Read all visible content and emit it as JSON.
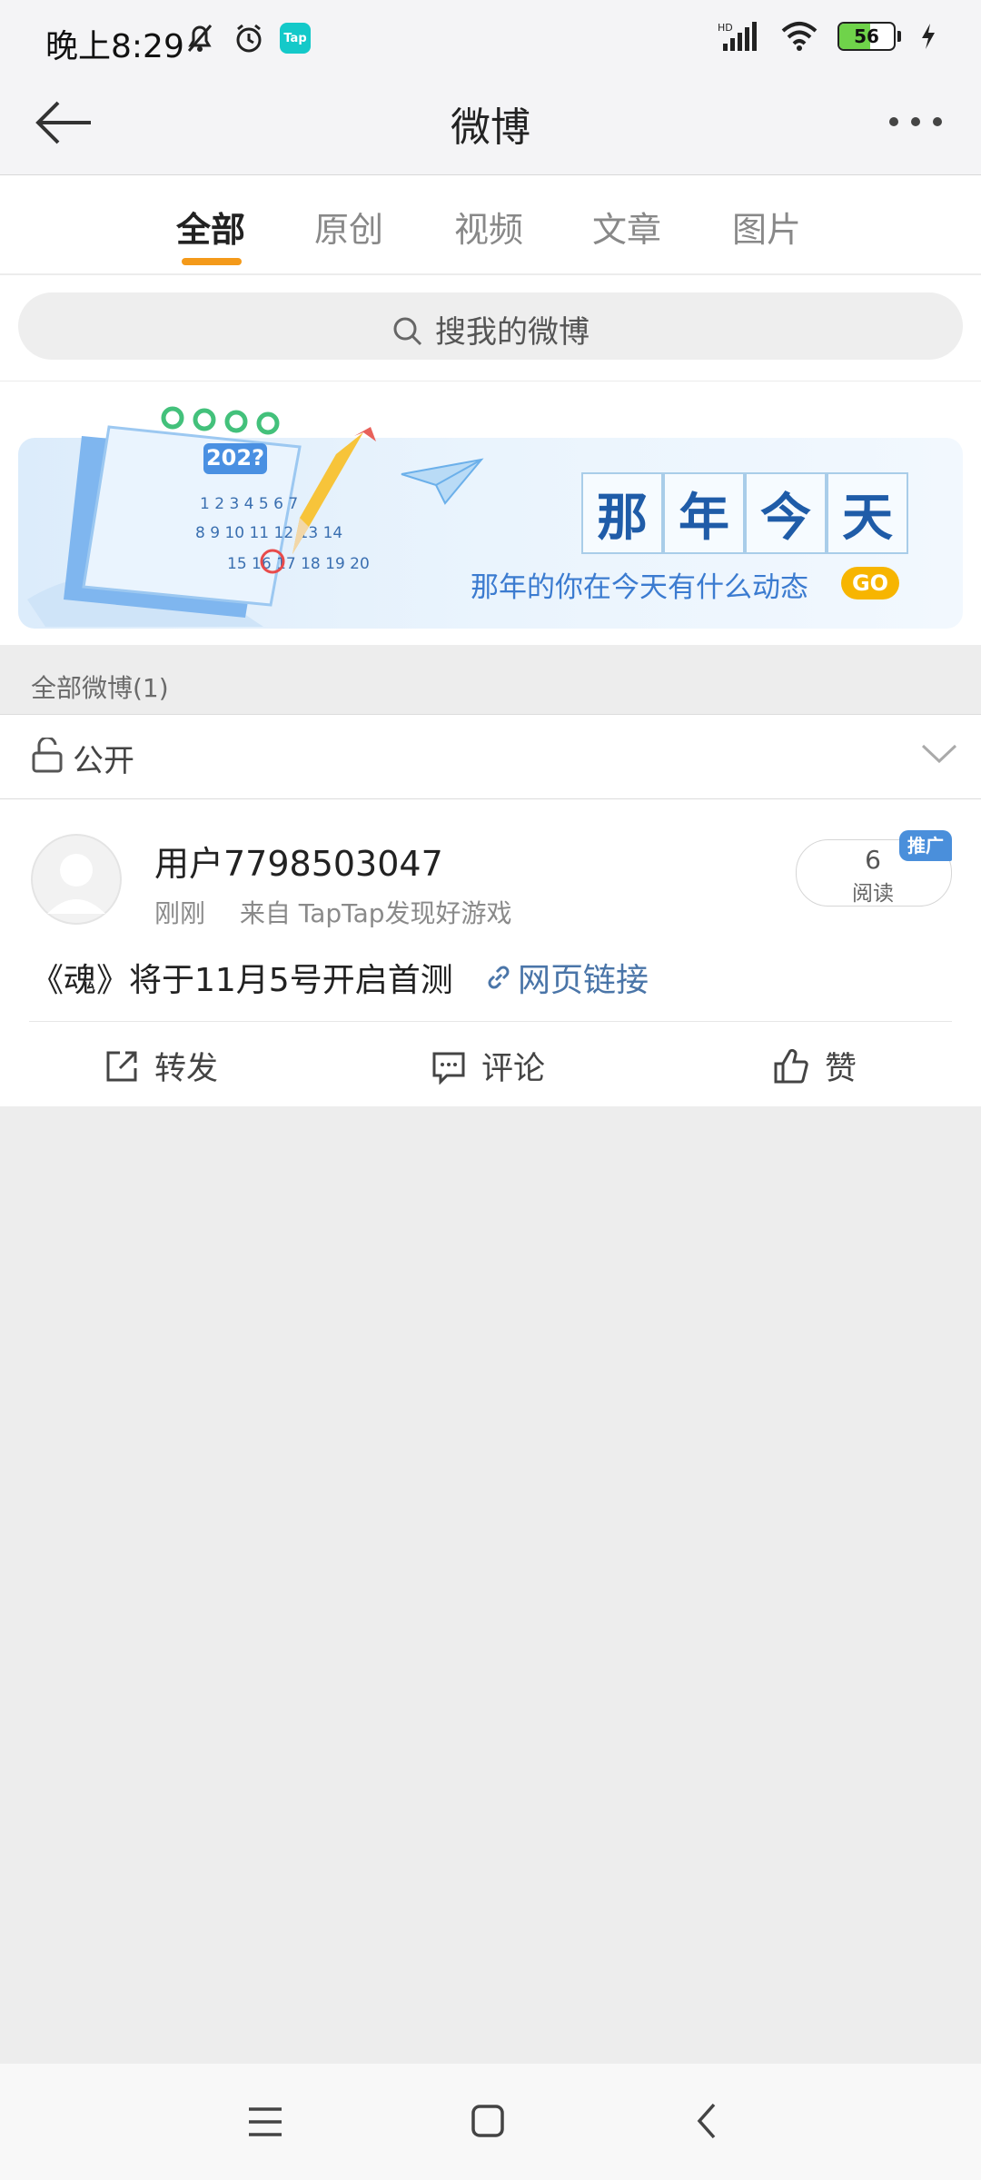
{
  "status_bar": {
    "time": "晚上8:29",
    "battery": "56",
    "app_badge": "Tap"
  },
  "header": {
    "title": "微博"
  },
  "tabs": [
    {
      "label": "全部",
      "active": true
    },
    {
      "label": "原创",
      "active": false
    },
    {
      "label": "视频",
      "active": false
    },
    {
      "label": "文章",
      "active": false
    },
    {
      "label": "图片",
      "active": false
    }
  ],
  "search": {
    "placeholder": "搜我的微博"
  },
  "banner": {
    "title_chars": [
      "那",
      "年",
      "今",
      "天"
    ],
    "subtitle": "那年的你在今天有什么动态",
    "go_label": "GO",
    "calendar_year": "202?"
  },
  "section": {
    "count_label": "全部微博(1)",
    "privacy_label": "公开"
  },
  "post": {
    "username": "用户7798503047",
    "time": "刚刚",
    "source": "来自 TapTap发现好游戏",
    "read_count": "6",
    "read_label": "阅读",
    "promo_badge": "推广",
    "text": "《魂》将于11月5号开启首测",
    "link_label": "网页链接",
    "actions": {
      "repost": "转发",
      "comment": "评论",
      "like": "赞"
    }
  },
  "colors": {
    "accent_underline": "#f49a1a",
    "link": "#4a75a8",
    "promo": "#4a8fdb",
    "go_button": "#f7b500",
    "banner_title": "#1f5ca8"
  }
}
